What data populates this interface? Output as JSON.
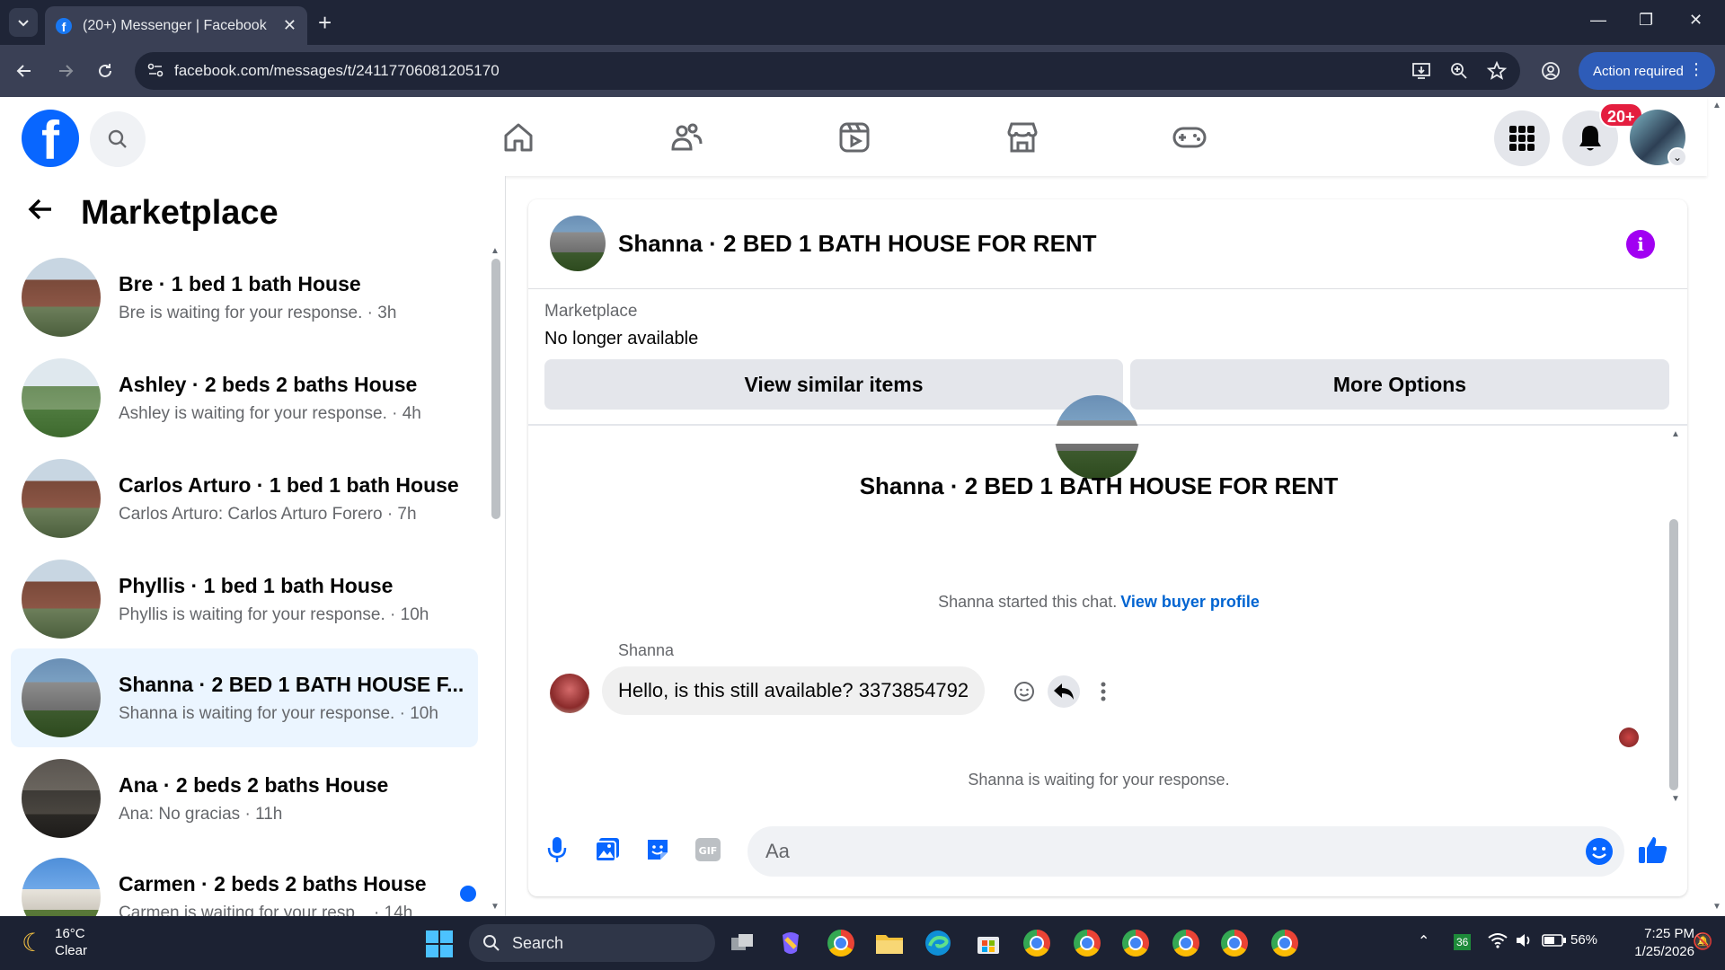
{
  "browser": {
    "tab_title": "(20+) Messenger | Facebook",
    "url": "facebook.com/messages/t/24117706081205170",
    "action_required": "Action required"
  },
  "fbnav": {
    "notification_count": "20+"
  },
  "left_panel": {
    "title": "Marketplace",
    "conversations": [
      {
        "name": "Bre · 1 bed 1 bath House",
        "sub": "Bre is waiting for your response. · 3h",
        "thumb": "house-brick"
      },
      {
        "name": "Ashley · 2 beds 2 baths House",
        "sub": "Ashley is waiting for your response. · 4h",
        "thumb": "house-green"
      },
      {
        "name": "Carlos Arturo · 1 bed 1 bath House",
        "sub": "Carlos Arturo: Carlos Arturo Forero · 7h",
        "thumb": "house-brick"
      },
      {
        "name": "Phyllis · 1 bed 1 bath House",
        "sub": "Phyllis is waiting for your response. · 10h",
        "thumb": "house-brick"
      },
      {
        "name": "Shanna · 2 BED 1 BATH HOUSE F...",
        "sub": "Shanna is waiting for your response. · 10h",
        "thumb": "house-gray"
      },
      {
        "name": "Ana · 2 beds 2 baths House",
        "sub": "Ana: No gracias · 11h",
        "thumb": "house-kitchen"
      },
      {
        "name": "Carmen · 2 beds 2 baths House",
        "sub": "Carmen is waiting for your resp... · 14h",
        "thumb": "house-blue"
      }
    ]
  },
  "chat": {
    "header_title": "Shanna · 2 BED 1 BATH HOUSE FOR RENT",
    "marketplace_label": "Marketplace",
    "listing_status": "No longer available",
    "btn_similar": "View similar items",
    "btn_more": "More Options",
    "center_title": "Shanna · 2 BED 1 BATH HOUSE FOR RENT",
    "started_text": "Shanna started this chat.",
    "view_buyer_profile": "View buyer profile",
    "sender_name": "Shanna",
    "message": "Hello, is this still available? 3373854792",
    "waiting_text": "Shanna is waiting for your response.",
    "composer_placeholder": "Aa"
  },
  "taskbar": {
    "temp": "16°C",
    "condition": "Clear",
    "search": "Search",
    "battery": "56%",
    "badge_36": "36",
    "time": "7:25 PM",
    "date": "1/25/2026"
  },
  "colors": {
    "fb_blue": "#0866ff",
    "info_purple": "#a100f2",
    "active_row": "#ebf5ff",
    "notif_red": "#e41e3f"
  }
}
